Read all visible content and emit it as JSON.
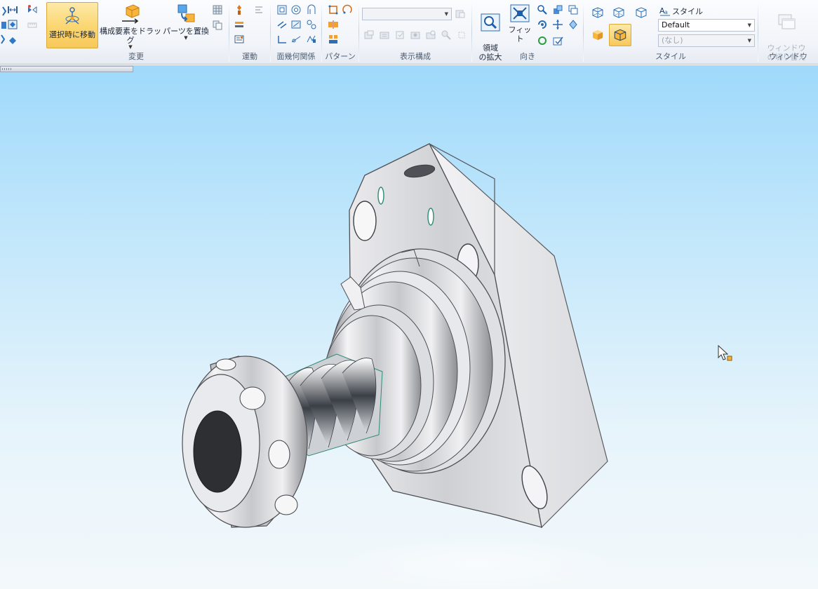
{
  "ribbon": {
    "groups": {
      "transform": {
        "label": "変更",
        "move_on_select": "選択時に移動",
        "drag_components": "構成要素をドラッグ",
        "replace_parts": "パーツを置換"
      },
      "motion": {
        "label": "運動"
      },
      "face_relations": {
        "label": "面幾何関係"
      },
      "pattern": {
        "label": "パターン"
      },
      "display_config": {
        "label": "表示構成"
      },
      "orient": {
        "label": "向き",
        "zoom_area": "領域\nの拡大",
        "fit": "フィット"
      },
      "style": {
        "label": "スタイル",
        "style_title": "スタイル",
        "style_value": "Default",
        "style_secondary": "(なし)"
      },
      "window": {
        "label": "ウィンドウ",
        "switch_window": "ウィンドウ\nの切り替え"
      }
    }
  },
  "colors": {
    "accent_active": "#fbd670",
    "viewport_top": "#9fd9fb",
    "viewport_bottom": "#f3f8fb",
    "part_gray": "#d6d7da"
  }
}
